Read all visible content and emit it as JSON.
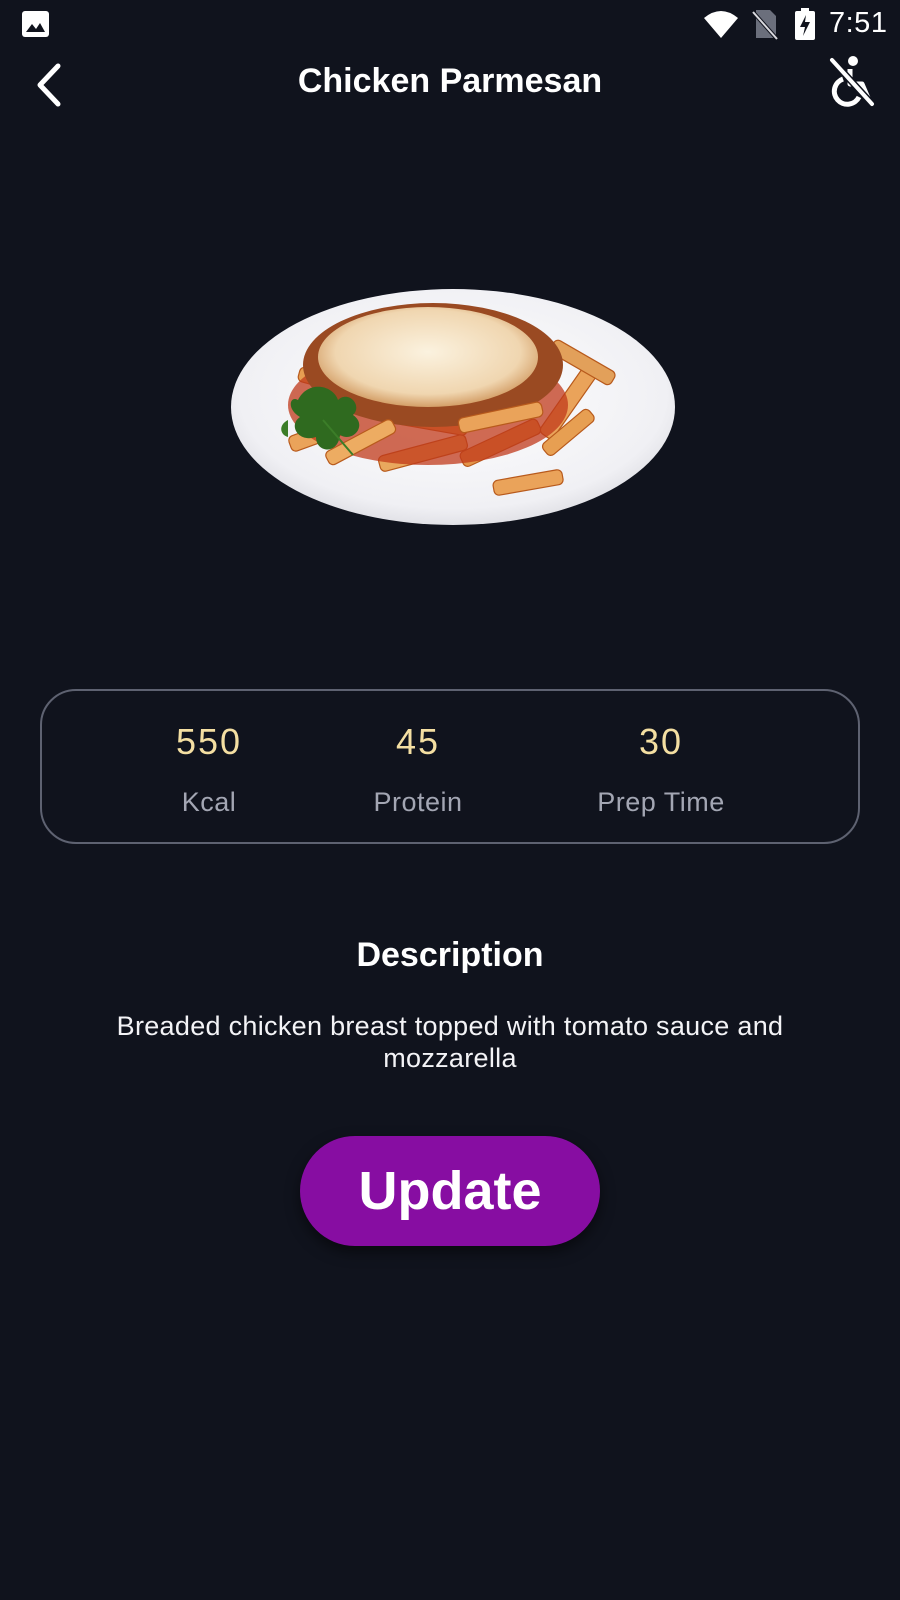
{
  "status_bar": {
    "time": "7:51",
    "icons": [
      "gallery-icon",
      "wifi-icon",
      "no-sim-icon",
      "battery-charging-icon"
    ]
  },
  "app_bar": {
    "title": "Chicken Parmesan",
    "back_icon": "back-arrow-icon",
    "action_icon": "accessibility-off-icon"
  },
  "dish": {
    "image": "chicken-parmesan-plate"
  },
  "stats": [
    {
      "value": "550",
      "label": "Kcal"
    },
    {
      "value": "45",
      "label": "Protein"
    },
    {
      "value": "30",
      "label": "Prep Time"
    }
  ],
  "description": {
    "title": "Description",
    "text": "Breaded chicken breast topped with tomato sauce and mozzarella"
  },
  "actions": {
    "update_label": "Update"
  },
  "colors": {
    "background": "#10131d",
    "stat_value": "#f4dfa2",
    "stat_label": "#a3a6b3",
    "card_border": "#5e6271",
    "button": "#870da2"
  }
}
